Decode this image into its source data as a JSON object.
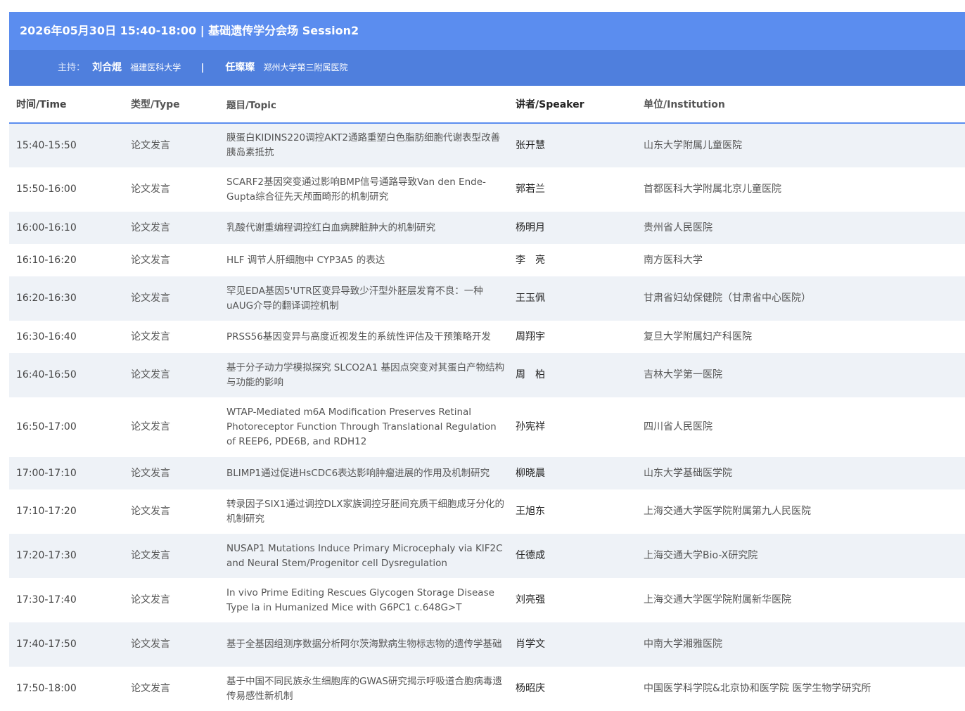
{
  "session": {
    "title": "2026年05月30日 15:40-18:00 | 基础遗传学分会场 Session2",
    "host_label": "主持：",
    "hosts": [
      {
        "name": "刘合焜",
        "institution": "福建医科大学"
      },
      {
        "name": "任璨璨",
        "institution": "郑州大学第三附属医院"
      }
    ],
    "separator": "|"
  },
  "table": {
    "headers": {
      "time": "时间/Time",
      "type": "类型/Type",
      "topic": "题目/Topic",
      "speaker": "讲者/Speaker",
      "institution": "单位/Institution"
    },
    "rows": [
      {
        "time": "15:40-15:50",
        "type": "论文发言",
        "topic": "膜蛋白KIDINS220调控AKT2通路重塑白色脂肪细胞代谢表型改善胰岛素抵抗",
        "speaker": "张开慧",
        "institution": "山东大学附属儿童医院"
      },
      {
        "time": "15:50-16:00",
        "type": "论文发言",
        "topic": "SCARF2基因突变通过影响BMP信号通路导致Van den Ende-Gupta综合征先天颅面畸形的机制研究",
        "speaker": "郭若兰",
        "institution": "首都医科大学附属北京儿童医院"
      },
      {
        "time": "16:00-16:10",
        "type": "论文发言",
        "topic": "乳酸代谢重编程调控红白血病脾脏肿大的机制研究",
        "speaker": "杨明月",
        "institution": "贵州省人民医院"
      },
      {
        "time": "16:10-16:20",
        "type": "论文发言",
        "topic": "HLF 调节人肝细胞中 CYP3A5 的表达",
        "speaker": "李　亮",
        "institution": "南方医科大学"
      },
      {
        "time": "16:20-16:30",
        "type": "论文发言",
        "topic": "罕见EDA基因5'UTR区变异导致少汗型外胚层发育不良：一种uAUG介导的翻译调控机制",
        "speaker": "王玉佩",
        "institution": "甘肃省妇幼保健院（甘肃省中心医院）"
      },
      {
        "time": "16:30-16:40",
        "type": "论文发言",
        "topic": "PRSS56基因变异与高度近视发生的系统性评估及干预策略开发",
        "speaker": "周翔宇",
        "institution": "复旦大学附属妇产科医院"
      },
      {
        "time": "16:40-16:50",
        "type": "论文发言",
        "topic": "基于分子动力学模拟探究 SLCO2A1 基因点突变对其蛋白产物结构与功能的影响",
        "speaker": "周　柏",
        "institution": "吉林大学第一医院"
      },
      {
        "time": "16:50-17:00",
        "type": "论文发言",
        "topic": "WTAP-Mediated m6A Modification Preserves Retinal Photoreceptor Function Through Translational Regulation of REEP6, PDE6B, and RDH12",
        "speaker": "孙宪祥",
        "institution": "四川省人民医院"
      },
      {
        "time": "17:00-17:10",
        "type": "论文发言",
        "topic": "BLIMP1通过促进HsCDC6表达影响肿瘤进展的作用及机制研究",
        "speaker": "柳晓晨",
        "institution": "山东大学基础医学院"
      },
      {
        "time": "17:10-17:20",
        "type": "论文发言",
        "topic": "转录因子SIX1通过调控DLX家族调控牙胚间充质干细胞成牙分化的机制研究",
        "speaker": "王旭东",
        "institution": "上海交通大学医学院附属第九人民医院"
      },
      {
        "time": "17:20-17:30",
        "type": "论文发言",
        "topic": "NUSAP1 Mutations Induce Primary Microcephaly via KIF2C and Neural Stem/Progenitor cell Dysregulation",
        "speaker": "任德成",
        "institution": "上海交通大学Bio-X研究院"
      },
      {
        "time": "17:30-17:40",
        "type": "论文发言",
        "topic": "In vivo Prime Editing Rescues Glycogen Storage Disease Type Ia in Humanized Mice with G6PC1 c.648G>T",
        "speaker": "刘亮强",
        "institution": "上海交通大学医学院附属新华医院"
      },
      {
        "time": "17:40-17:50",
        "type": "论文发言",
        "topic": "基于全基因组测序数据分析阿尔茨海默病生物标志物的遗传学基础",
        "speaker": "肖学文",
        "institution": "中南大学湘雅医院"
      },
      {
        "time": "17:50-18:00",
        "type": "论文发言",
        "topic": "基于中国不同民族永生细胞库的GWAS研究揭示呼吸道合胞病毒遗传易感性新机制",
        "speaker": "杨昭庆",
        "institution": "中国医学科学院&北京协和医学院 医学生物学研究所"
      }
    ]
  }
}
